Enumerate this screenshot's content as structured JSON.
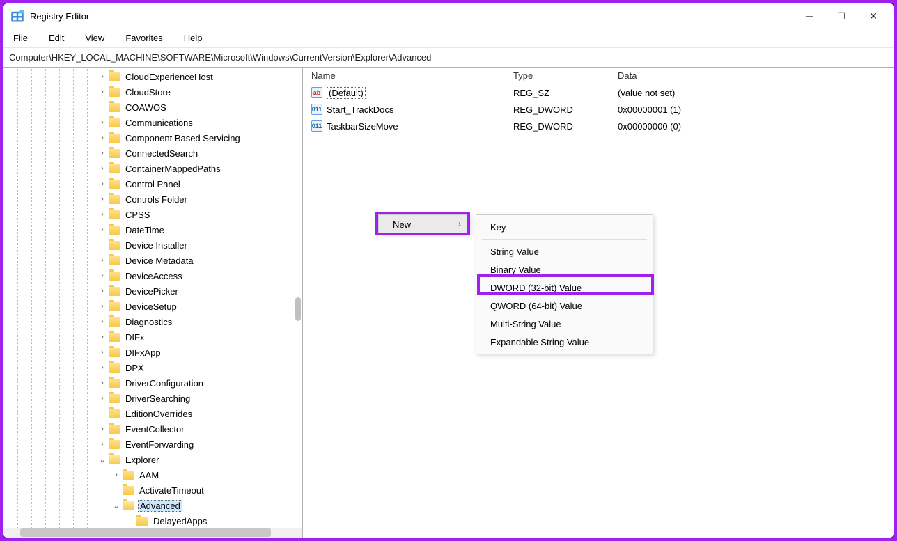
{
  "window": {
    "title": "Registry Editor"
  },
  "menu": {
    "file": "File",
    "edit": "Edit",
    "view": "View",
    "favorites": "Favorites",
    "help": "Help"
  },
  "address": "Computer\\HKEY_LOCAL_MACHINE\\SOFTWARE\\Microsoft\\Windows\\CurrentVersion\\Explorer\\Advanced",
  "tree": [
    {
      "label": "CloudExperienceHost",
      "indent": 135,
      "chev": "›"
    },
    {
      "label": "CloudStore",
      "indent": 135,
      "chev": "›"
    },
    {
      "label": "COAWOS",
      "indent": 135,
      "chev": ""
    },
    {
      "label": "Communications",
      "indent": 135,
      "chev": "›"
    },
    {
      "label": "Component Based Servicing",
      "indent": 135,
      "chev": "›"
    },
    {
      "label": "ConnectedSearch",
      "indent": 135,
      "chev": "›"
    },
    {
      "label": "ContainerMappedPaths",
      "indent": 135,
      "chev": "›"
    },
    {
      "label": "Control Panel",
      "indent": 135,
      "chev": "›"
    },
    {
      "label": "Controls Folder",
      "indent": 135,
      "chev": "›"
    },
    {
      "label": "CPSS",
      "indent": 135,
      "chev": "›"
    },
    {
      "label": "DateTime",
      "indent": 135,
      "chev": "›"
    },
    {
      "label": "Device Installer",
      "indent": 135,
      "chev": ""
    },
    {
      "label": "Device Metadata",
      "indent": 135,
      "chev": "›"
    },
    {
      "label": "DeviceAccess",
      "indent": 135,
      "chev": "›"
    },
    {
      "label": "DevicePicker",
      "indent": 135,
      "chev": "›"
    },
    {
      "label": "DeviceSetup",
      "indent": 135,
      "chev": "›"
    },
    {
      "label": "Diagnostics",
      "indent": 135,
      "chev": "›"
    },
    {
      "label": "DIFx",
      "indent": 135,
      "chev": "›"
    },
    {
      "label": "DIFxApp",
      "indent": 135,
      "chev": "›"
    },
    {
      "label": "DPX",
      "indent": 135,
      "chev": "›"
    },
    {
      "label": "DriverConfiguration",
      "indent": 135,
      "chev": "›"
    },
    {
      "label": "DriverSearching",
      "indent": 135,
      "chev": "›"
    },
    {
      "label": "EditionOverrides",
      "indent": 135,
      "chev": ""
    },
    {
      "label": "EventCollector",
      "indent": 135,
      "chev": "›"
    },
    {
      "label": "EventForwarding",
      "indent": 135,
      "chev": "›"
    },
    {
      "label": "Explorer",
      "indent": 135,
      "chev": "⌄",
      "open": true
    },
    {
      "label": "AAM",
      "indent": 155,
      "chev": "›"
    },
    {
      "label": "ActivateTimeout",
      "indent": 155,
      "chev": ""
    },
    {
      "label": "Advanced",
      "indent": 155,
      "chev": "⌄",
      "open": true,
      "selected": true
    },
    {
      "label": "DelayedApps",
      "indent": 175,
      "chev": ""
    }
  ],
  "columns": {
    "name": "Name",
    "type": "Type",
    "data": "Data"
  },
  "values": [
    {
      "icon": "ab",
      "name": "(Default)",
      "type": "REG_SZ",
      "data": "(value not set)",
      "sel": true
    },
    {
      "icon": "011",
      "name": "Start_TrackDocs",
      "type": "REG_DWORD",
      "data": "0x00000001 (1)"
    },
    {
      "icon": "011",
      "name": "TaskbarSizeMove",
      "type": "REG_DWORD",
      "data": "0x00000000 (0)"
    }
  ],
  "contextmenu": {
    "new": "New"
  },
  "submenu": {
    "key": "Key",
    "string": "String Value",
    "binary": "Binary Value",
    "dword": "DWORD (32-bit) Value",
    "qword": "QWORD (64-bit) Value",
    "multi": "Multi-String Value",
    "expand": "Expandable String Value"
  }
}
